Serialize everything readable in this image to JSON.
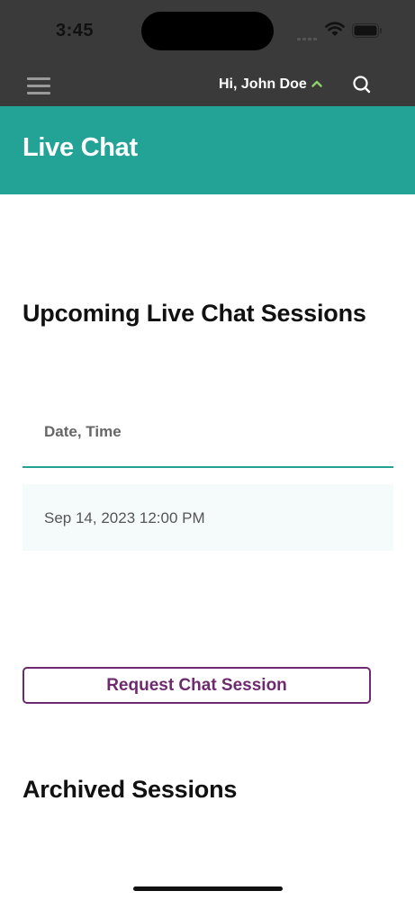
{
  "status_bar": {
    "time": "3:45",
    "icons": [
      "signal-icon",
      "wifi-icon",
      "battery-icon"
    ]
  },
  "header": {
    "greeting": "Hi, John Doe",
    "icons": [
      "hamburger-menu-icon",
      "chevron-up-icon",
      "search-icon"
    ]
  },
  "banner": {
    "title": "Live Chat"
  },
  "upcoming": {
    "title": "Upcoming Live Chat Sessions",
    "columns": [
      "Date, Time"
    ],
    "rows": [
      [
        "Sep 14, 2023 12:00 PM"
      ]
    ]
  },
  "actions": {
    "request_label": "Request Chat Session"
  },
  "archived": {
    "title": "Archived Sessions"
  },
  "colors": {
    "header_bg": "#3a3a3a",
    "teal_accent": "#23a296",
    "purple_accent": "#6e2a6e",
    "chevron_green": "#8ccf6b",
    "row_bg": "#f5fbfb"
  }
}
